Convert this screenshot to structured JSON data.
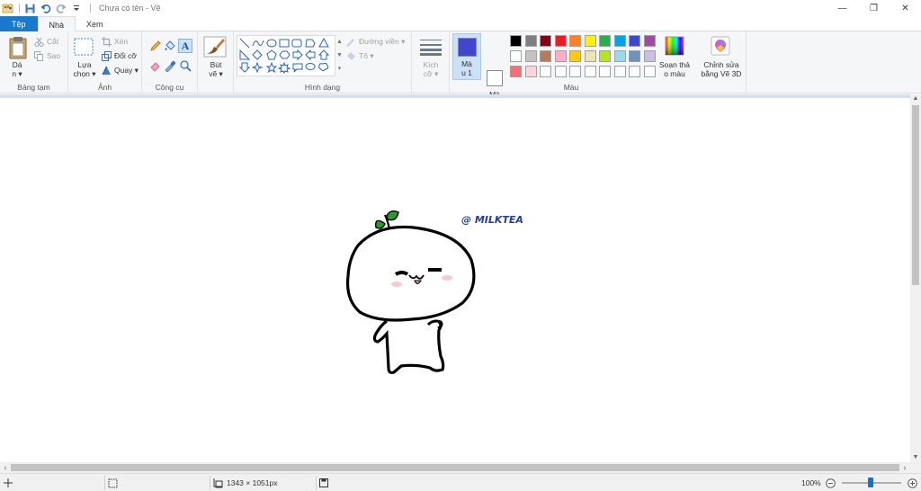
{
  "window": {
    "title": "Chưa có tên - Vẽ",
    "min": "—",
    "restore": "❐",
    "close": "✕"
  },
  "tabs": [
    {
      "label": "Tệp"
    },
    {
      "label": "Nhà"
    },
    {
      "label": "Xem"
    }
  ],
  "ribbon": {
    "clipboard": {
      "label": "Bảng tạm",
      "paste_line1": "Dá",
      "paste_line2": "n ▾",
      "cut": "Cắt",
      "copy": "Sao"
    },
    "image": {
      "label": "Ảnh",
      "select_line1": "Lựa",
      "select_line2": "chọn ▾",
      "crop": "Xén",
      "resize": "Đổi cỡ",
      "rotate": "Quay ▾"
    },
    "tools": {
      "label": "Công cụ"
    },
    "brushes": {
      "line1": "Bút",
      "line2": "vẽ ▾"
    },
    "shapes": {
      "label": "Hình dạng",
      "outline": "Đường viền ▾",
      "fill": "Tô ▾"
    },
    "size": {
      "line1": "Kích",
      "line2": "cỡ ▾"
    },
    "color1": {
      "line1": "Mà",
      "line2": "u 1"
    },
    "color2": {
      "line1": "Mà",
      "line2": "u 2"
    },
    "colors": {
      "label": "Màu",
      "color1": "#3f48cc",
      "color2": "#ffffff",
      "palette_row1": [
        "#000000",
        "#7f7f7f",
        "#880015",
        "#ed1c24",
        "#ff7f27",
        "#fff200",
        "#22b14c",
        "#00a2e8",
        "#3f48cc",
        "#a349a4"
      ],
      "palette_row2": [
        "#ffffff",
        "#c3c3c3",
        "#b97a57",
        "#ffaec9",
        "#ffc90e",
        "#efe4b0",
        "#b5e61d",
        "#99d9ea",
        "#7092be",
        "#c8bfe7"
      ],
      "palette_row3": [
        "#f0707a",
        "#ffd3da",
        "#ffffff",
        "#ffffff",
        "#ffffff",
        "#ffffff",
        "#ffffff",
        "#ffffff",
        "#ffffff",
        "#ffffff"
      ]
    },
    "edit_colors": {
      "line1": "Soạn thả",
      "line2": "o màu"
    },
    "paint3d": {
      "line1": "Chỉnh sửa",
      "line2": "bằng Vẽ 3D"
    }
  },
  "drawing": {
    "watermark": "@ MILKTEA"
  },
  "status": {
    "dimensions": "1343 × 1051px",
    "zoom": "100%"
  }
}
